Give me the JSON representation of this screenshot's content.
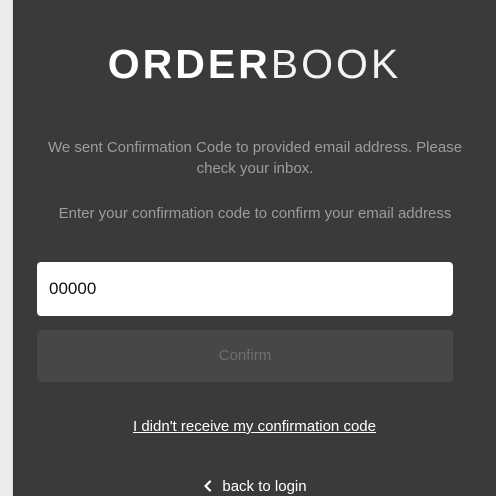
{
  "logo": {
    "bold_part": "ORDER",
    "light_part": "BOOK"
  },
  "messages": {
    "sent": "We sent Confirmation Code to provided email address. Please check your inbox.",
    "enter": "Enter your confirmation code to confirm your email address"
  },
  "code_field": {
    "value": "00000"
  },
  "confirm_button": {
    "label": "Confirm"
  },
  "links": {
    "resend": "I didn't receive my confirmation code",
    "back": "back to login"
  },
  "icons": {
    "back": "chevron-left-icon"
  },
  "colors": {
    "panel_background": "#3a3a3a",
    "button_disabled": "#474747",
    "muted_text": "#9c9c9c"
  }
}
